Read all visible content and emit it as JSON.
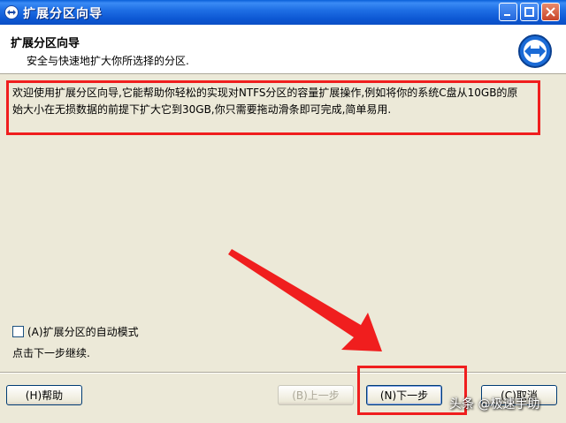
{
  "window": {
    "title": "扩展分区向导"
  },
  "header": {
    "title": "扩展分区向导",
    "subtitle": "安全与快速地扩大你所选择的分区."
  },
  "main": {
    "description": "欢迎使用扩展分区向导,它能帮助你轻松的实现对NTFS分区的容量扩展操作,例如将你的系统C盘从10GB的原始大小在无损数据的前提下扩大它到30GB,你只需要拖动滑条即可完成,简单易用.",
    "auto_mode_label": "(A)扩展分区的自动模式",
    "auto_mode_checked": false,
    "hint": "点击下一步继续."
  },
  "buttons": {
    "help": "(H)帮助",
    "back": "(B)上一步",
    "next": "(N)下一步",
    "cancel": "(C)取消"
  },
  "watermark": "头条 @极速手助",
  "colors": {
    "annotation_red": "#f01e1e",
    "titlebar_blue": "#0d58d4"
  }
}
